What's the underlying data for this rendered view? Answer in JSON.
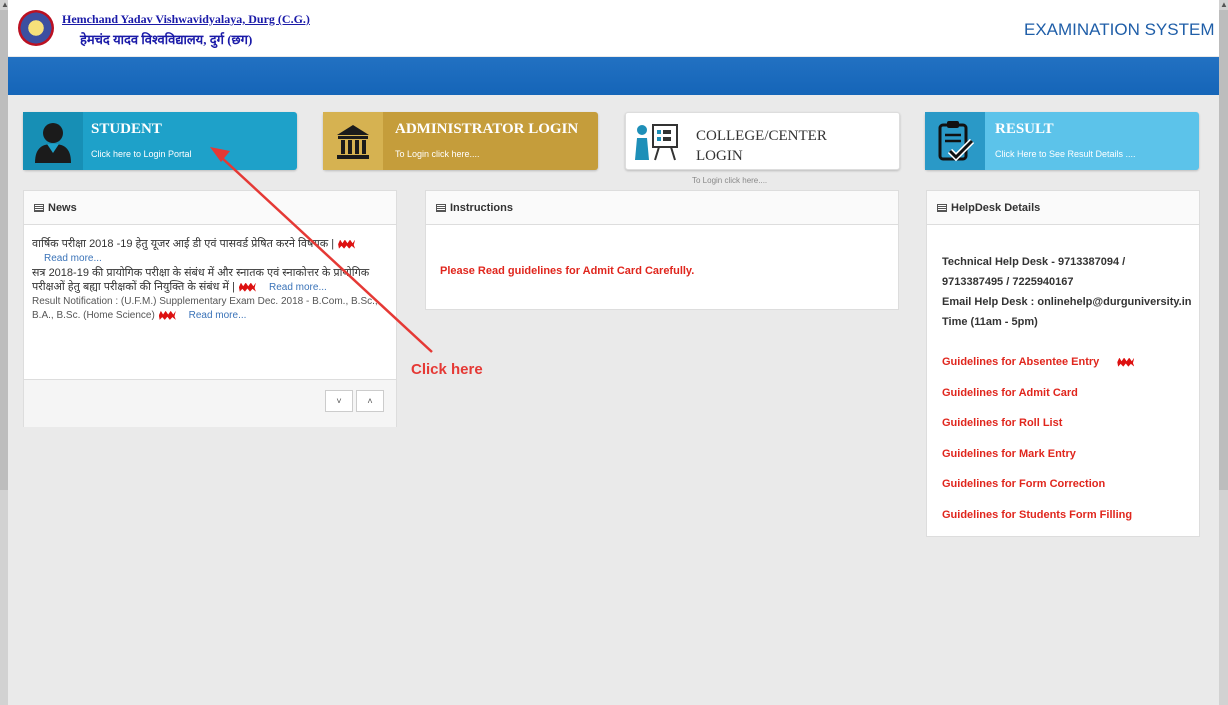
{
  "header": {
    "university_en": "Hemchand Yadav Vishwavidyalaya, Durg (C.G.)",
    "university_hi": "हेमचंद यादव विश्वविद्यालय, दुर्ग (छग)",
    "system_title": "EXAMINATION SYSTEM"
  },
  "tiles": {
    "student": {
      "title": "STUDENT",
      "subtitle": "Click here to Login Portal",
      "icon": "user-icon",
      "color": "#1ea1c9"
    },
    "admin": {
      "title": "ADMINISTRATOR LOGIN",
      "subtitle": "To Login click here....",
      "icon": "building-icon",
      "color": "#c59d3b"
    },
    "college": {
      "title_line1": "COLLEGE/CENTER",
      "title_line2": "LOGIN",
      "subtitle": "To Login click here....",
      "icon": "presentation-icon"
    },
    "result": {
      "title": "RESULT",
      "subtitle": "Click Here to See Result Details ....",
      "icon": "clipboard-check-icon",
      "color": "#5cc3ea"
    }
  },
  "news": {
    "title": "News",
    "items": [
      {
        "text": "वार्षिक परीक्षा 2018 -19 हेतु यूजर आई डी एवं पासवर्ड प्रेषित करने विषयक |",
        "link": "Read more..."
      },
      {
        "text": "सत्र 2018-19 की प्रायोगिक परीक्षा के संबंध में और स्नातक एवं स्नाकोत्तर के प्रायोगिक परीक्षओं हेतु बह्या परीक्षकों की नियुक्ति के संबंध में |",
        "link": "Read more..."
      },
      {
        "text": "Result Notification : (U.F.M.) Supplementary Exam Dec. 2018 - B.Com., B.Sc., B.A., B.Sc. (Home Science)",
        "link": "Read more..."
      }
    ],
    "down_label": "˅",
    "up_label": "˄"
  },
  "instructions": {
    "title": "Instructions",
    "text": "Please Read guidelines for Admit Card Carefully."
  },
  "helpdesk": {
    "title": "HelpDesk Details",
    "line1": "Technical Help Desk - 9713387094 /",
    "line2": "9713387495 / 7225940167",
    "line3": "Email Help Desk : onlinehelp@durguniversity.in",
    "line4": "Time (11am - 5pm)",
    "guidelines": [
      "Guidelines for Absentee Entry",
      "Guidelines for Admit Card",
      "Guidelines for Roll List",
      "Guidelines for Mark Entry",
      "Guidelines for Form Correction",
      "Guidelines for Students Form Filling"
    ]
  },
  "annotation": {
    "label": "Click here",
    "color": "#e53935"
  }
}
